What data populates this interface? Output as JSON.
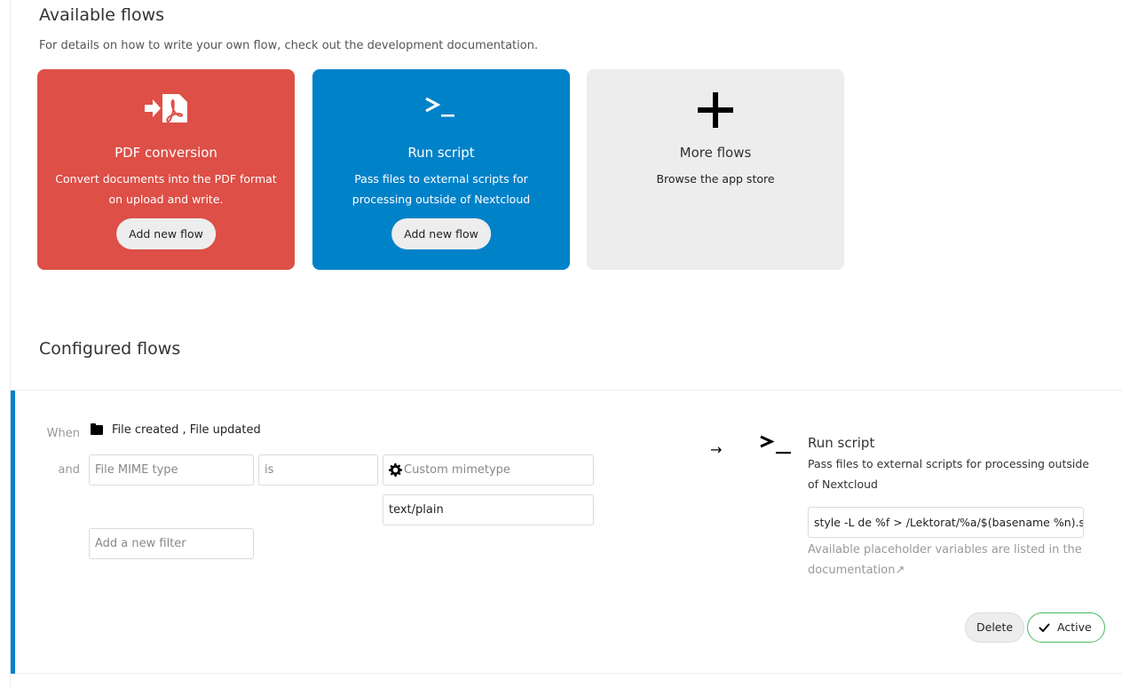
{
  "available": {
    "heading": "Available flows",
    "intro": "For details on how to write your own flow, check out the development documentation.",
    "cards": [
      {
        "title": "PDF conversion",
        "description": "Convert documents into the PDF format on upload and write.",
        "button": "Add new flow",
        "icon": "pdf-convert-icon",
        "color": "#dd4f47"
      },
      {
        "title": "Run script",
        "description": "Pass files to external scripts for processing outside of Nextcloud",
        "button": "Add new flow",
        "icon": "terminal-icon",
        "color": "#0082c9"
      },
      {
        "title": "More flows",
        "description": "Browse the app store",
        "icon": "plus-icon",
        "color": "#ededed"
      }
    ]
  },
  "configured": {
    "heading": "Configured flows",
    "flow": {
      "when_label": "When",
      "and_label": "and",
      "events": "File created ,  File updated",
      "check": {
        "field": "File MIME type",
        "operator": "is",
        "value_select": "Custom mimetype",
        "value_input": "text/plain"
      },
      "add_filter_placeholder": "Add a new filter",
      "operation": {
        "title": "Run script",
        "description": "Pass files to external scripts for processing outside of Nextcloud",
        "command": "style -L de %f > /Lektorat/%a/$(basename %n).st",
        "hint": "Available placeholder variables are listed in the documentation↗"
      },
      "delete_label": "Delete",
      "active_label": "Active",
      "accent_color": "#0082c9",
      "active_color": "#46ba61"
    }
  }
}
